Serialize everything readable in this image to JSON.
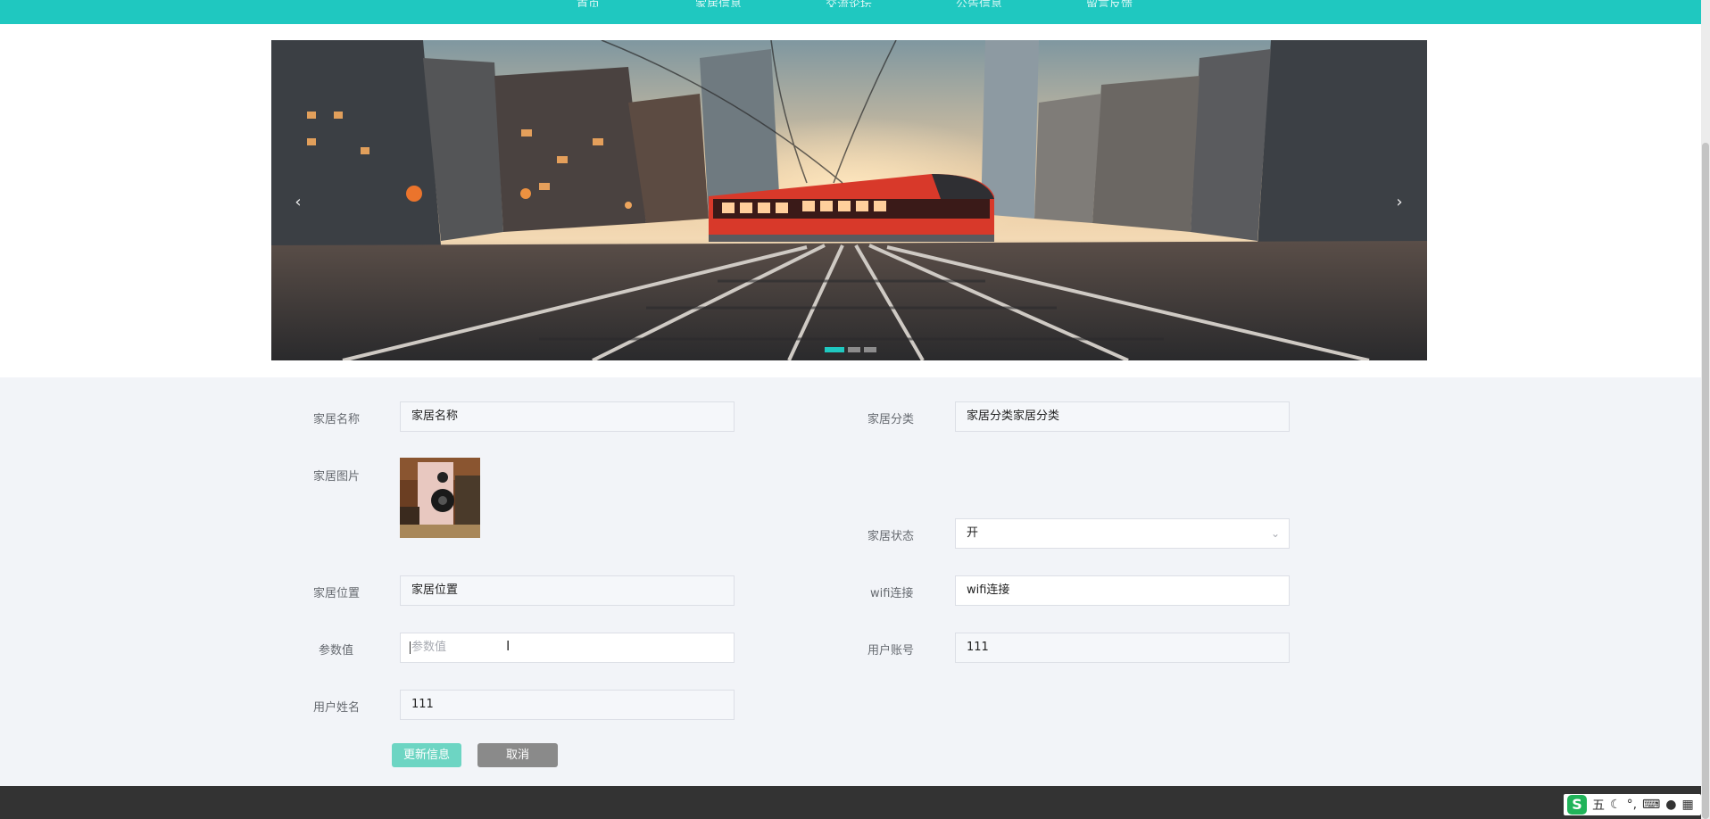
{
  "nav": {
    "items": [
      "首页",
      "家居信息",
      "交流论坛",
      "公告信息",
      "留言反馈"
    ]
  },
  "carousel": {
    "prev": "‹",
    "next": "›",
    "slide_count": 3,
    "active_slide": 1
  },
  "form": {
    "name_label": "家居名称",
    "name_value": "家居名称",
    "category_label": "家居分类",
    "category_value": "家居分类家居分类",
    "image_label": "家居图片",
    "status_label": "家居状态",
    "status_value": "开",
    "location_label": "家居位置",
    "location_value": "家居位置",
    "wifi_label": "wifi连接",
    "wifi_value": "wifi连接",
    "param_label": "参数值",
    "param_placeholder": "参数值",
    "account_label": "用户账号",
    "account_value": "111",
    "username_label": "用户姓名",
    "username_value": "111"
  },
  "buttons": {
    "update": "更新信息",
    "cancel": "取消"
  },
  "ime": {
    "logo": "S",
    "mode": "五",
    "icons": [
      "moon-icon",
      "punctuation-icon",
      "keyboard-icon",
      "user-icon",
      "grid-icon"
    ]
  },
  "colors": {
    "accent": "#1fc8c0",
    "update_button": "#6dd5c3",
    "cancel_button": "#8a8a8a",
    "footer": "#333333"
  }
}
